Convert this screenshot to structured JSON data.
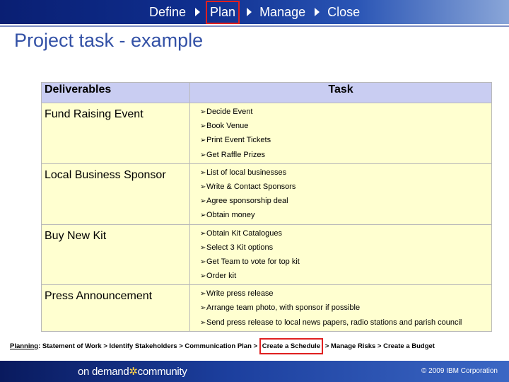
{
  "nav": {
    "steps": [
      "Define",
      "Plan",
      "Manage",
      "Close"
    ],
    "active_step": "Plan"
  },
  "title": "Project task -  example",
  "table": {
    "headers": {
      "deliverables": "Deliverables",
      "task": "Task"
    },
    "rows": [
      {
        "deliverable": "Fund Raising Event",
        "tasks": [
          "Decide Event",
          "Book Venue",
          "Print Event Tickets",
          "Get Raffle Prizes"
        ]
      },
      {
        "deliverable": "Local Business Sponsor",
        "tasks": [
          "List of local businesses",
          "Write & Contact Sponsors",
          "Agree sponsorship deal",
          "Obtain money"
        ]
      },
      {
        "deliverable": "Buy New Kit",
        "tasks": [
          "Obtain Kit Catalogues",
          "Select 3 Kit options",
          "Get Team to vote for top kit",
          "Order kit"
        ]
      },
      {
        "deliverable": "Press Announcement",
        "tasks": [
          "Write press release",
          "Arrange team photo, with sponsor if possible",
          "Send press release to local news papers, radio stations and parish council"
        ]
      }
    ]
  },
  "planning": {
    "lead": "Planning",
    "before": ": Statement of Work > Identify Stakeholders > Communication Plan >",
    "highlight": "Create a Schedule",
    "after": "> Manage Risks > Create a Budget"
  },
  "footer": {
    "logo_part1": "on demand",
    "logo_part2": "community",
    "copyright": "© 2009 IBM Corporation"
  },
  "colors": {
    "header_row": "#c9cdf2",
    "body_cells": "#ffffd0",
    "title": "#3351a6",
    "highlight_border": "#e02020"
  }
}
